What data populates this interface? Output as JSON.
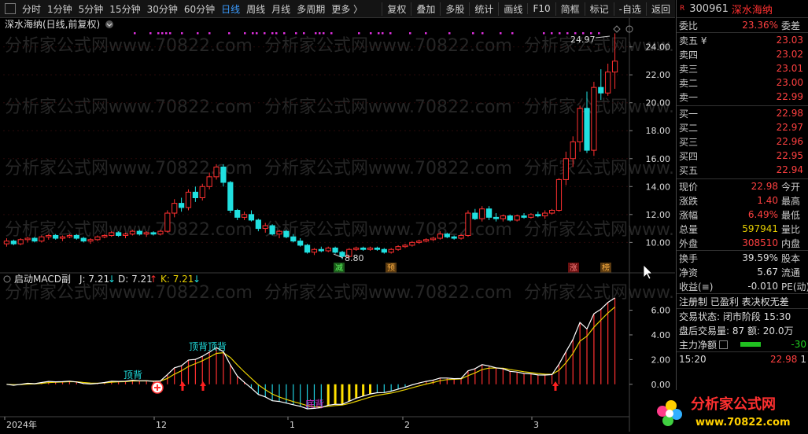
{
  "toolbar": {
    "periods": [
      "分时",
      "1分钟",
      "5分钟",
      "15分钟",
      "30分钟",
      "60分钟",
      "日线",
      "周线",
      "月线",
      "多周期",
      "更多 〉"
    ],
    "active": "日线",
    "actions": [
      "复权",
      "叠加",
      "多股",
      "统计",
      "画线",
      "F10",
      "简框",
      "标记",
      "-自选",
      "返回"
    ]
  },
  "chart": {
    "title": "深水海纳(日线,前复权)",
    "watermark": "分析家公式网www.70822.com",
    "y_ticks": [
      "24.00",
      "22.00",
      "20.00",
      "18.00",
      "16.00",
      "14.00",
      "12.00",
      "10.00"
    ],
    "high_label": "24.97",
    "low_label": "8.80",
    "tags": [
      "减",
      "预",
      "涨",
      "榜"
    ],
    "indicator_name": "启动MACD副",
    "ind_j": "J: 7.21",
    "ind_d": "D: 7.21",
    "ind_k": "K: 7.21",
    "ind_ticks": [
      "6.00",
      "4.00",
      "2.00",
      "0.00"
    ],
    "ann_dingbei1": "顶背",
    "ann_dingbei2": "顶背顶背",
    "ann_dibei": "底背",
    "x_labels": [
      "2024年",
      "12",
      "1",
      "2",
      "3"
    ]
  },
  "panel": {
    "badge": "R",
    "code": "300961",
    "name": "深水海纳",
    "weibi_label": "委比",
    "weibi_value": "23.36%",
    "weicha_label": "委差",
    "sells": [
      {
        "label": "卖五 ¥",
        "price": "23.03"
      },
      {
        "label": "卖四",
        "price": "23.02"
      },
      {
        "label": "卖三",
        "price": "23.01"
      },
      {
        "label": "卖二",
        "price": "23.00"
      },
      {
        "label": "卖一",
        "price": "22.99"
      }
    ],
    "buys": [
      {
        "label": "买一",
        "price": "22.98"
      },
      {
        "label": "买二",
        "price": "22.97"
      },
      {
        "label": "买三",
        "price": "22.96"
      },
      {
        "label": "买四",
        "price": "22.95"
      },
      {
        "label": "买五",
        "price": "22.94"
      }
    ],
    "quote": [
      {
        "l": "现价",
        "v": "22.98",
        "l2": "今开"
      },
      {
        "l": "涨跌",
        "v": "1.40",
        "l2": "最高"
      },
      {
        "l": "涨幅",
        "v": "6.49%",
        "l2": "最低"
      },
      {
        "l": "总量",
        "v": "597941",
        "l2": "量比"
      },
      {
        "l": "外盘",
        "v": "308510",
        "l2": "内盘"
      }
    ],
    "stats": [
      {
        "l": "换手",
        "v": "39.59%",
        "l2": "股本"
      },
      {
        "l": "净资",
        "v": "5.67",
        "l2": "流通"
      },
      {
        "l": "收益(≡)",
        "v": "-0.010",
        "l2": "PE(动)"
      }
    ],
    "info1": "注册制 已盈利 表决权无差",
    "info2": "交易状态: 闭市阶段 15:30",
    "info3": "盘后交易量: 87  额: 20.0万",
    "info4": "主力净额",
    "info4_val": "-30",
    "time_row": "15:20",
    "time_price": "22.98",
    "time_extra": "1"
  },
  "logo": {
    "text": "分析家公式网",
    "url": "www.70822.com"
  },
  "colors": {
    "up": "#ff3030",
    "down": "#20e0e0",
    "bg": "#000000",
    "accent": "#3a9bff"
  },
  "chart_data": {
    "type": "candlestick",
    "ohlc": [
      [
        9.9,
        10.3,
        9.7,
        10.1
      ],
      [
        10.1,
        10.2,
        9.8,
        9.9
      ],
      [
        9.9,
        10.3,
        9.8,
        10.2
      ],
      [
        10.2,
        10.4,
        10.0,
        10.3
      ],
      [
        10.3,
        10.4,
        10.0,
        10.1
      ],
      [
        10.1,
        10.5,
        10.0,
        10.4
      ],
      [
        10.4,
        10.6,
        10.2,
        10.5
      ],
      [
        10.5,
        10.6,
        10.2,
        10.3
      ],
      [
        10.3,
        10.5,
        10.1,
        10.4
      ],
      [
        10.4,
        10.6,
        10.3,
        10.5
      ],
      [
        10.5,
        10.6,
        10.2,
        10.3
      ],
      [
        10.3,
        10.4,
        10.0,
        10.1
      ],
      [
        10.1,
        10.3,
        9.9,
        10.2
      ],
      [
        10.2,
        10.5,
        10.1,
        10.4
      ],
      [
        10.4,
        10.6,
        10.3,
        10.5
      ],
      [
        10.5,
        10.8,
        10.4,
        10.7
      ],
      [
        10.7,
        10.8,
        10.4,
        10.5
      ],
      [
        10.5,
        10.7,
        10.3,
        10.6
      ],
      [
        10.6,
        10.9,
        10.5,
        10.8
      ],
      [
        10.8,
        10.9,
        10.5,
        10.6
      ],
      [
        10.6,
        10.8,
        10.4,
        10.7
      ],
      [
        10.7,
        10.8,
        10.5,
        10.6
      ],
      [
        10.6,
        10.9,
        10.5,
        10.8
      ],
      [
        10.8,
        12.3,
        10.7,
        12.1
      ],
      [
        12.1,
        13.1,
        11.8,
        12.8
      ],
      [
        12.8,
        13.2,
        12.2,
        12.5
      ],
      [
        12.5,
        13.8,
        12.3,
        13.6
      ],
      [
        13.6,
        14.0,
        12.9,
        13.2
      ],
      [
        13.2,
        14.2,
        13.0,
        14.0
      ],
      [
        14.0,
        15.0,
        13.8,
        14.7
      ],
      [
        14.7,
        15.6,
        14.5,
        15.4
      ],
      [
        15.4,
        15.6,
        14.0,
        14.3
      ],
      [
        14.3,
        14.4,
        12.1,
        12.3
      ],
      [
        12.3,
        12.4,
        11.6,
        11.8
      ],
      [
        11.8,
        12.2,
        11.6,
        12.0
      ],
      [
        12.0,
        12.3,
        11.5,
        11.6
      ],
      [
        11.6,
        11.7,
        10.8,
        11.0
      ],
      [
        11.0,
        11.4,
        10.7,
        11.2
      ],
      [
        11.2,
        11.3,
        10.5,
        10.6
      ],
      [
        10.6,
        10.9,
        10.3,
        10.8
      ],
      [
        10.8,
        10.9,
        10.3,
        10.4
      ],
      [
        10.4,
        10.6,
        10.0,
        10.1
      ],
      [
        10.1,
        10.3,
        9.7,
        9.8
      ],
      [
        9.8,
        9.9,
        9.2,
        9.3
      ],
      [
        9.3,
        9.6,
        9.1,
        9.5
      ],
      [
        9.5,
        9.7,
        9.3,
        9.4
      ],
      [
        9.4,
        9.7,
        9.3,
        9.6
      ],
      [
        9.6,
        9.7,
        9.2,
        9.3
      ],
      [
        9.3,
        9.4,
        8.8,
        9.0
      ],
      [
        9.0,
        9.6,
        8.9,
        9.5
      ],
      [
        9.5,
        9.7,
        9.4,
        9.6
      ],
      [
        9.6,
        9.7,
        9.4,
        9.5
      ],
      [
        9.5,
        9.7,
        9.4,
        9.6
      ],
      [
        9.6,
        9.7,
        9.4,
        9.5
      ],
      [
        9.5,
        9.6,
        9.2,
        9.3
      ],
      [
        9.3,
        9.6,
        9.2,
        9.5
      ],
      [
        9.5,
        9.8,
        9.4,
        9.7
      ],
      [
        9.7,
        9.9,
        9.6,
        9.8
      ],
      [
        9.8,
        10.1,
        9.7,
        10.0
      ],
      [
        10.0,
        10.2,
        9.9,
        10.1
      ],
      [
        10.1,
        10.3,
        10.0,
        10.2
      ],
      [
        10.2,
        10.4,
        10.1,
        10.3
      ],
      [
        10.3,
        10.8,
        10.2,
        10.6
      ],
      [
        10.6,
        10.7,
        10.3,
        10.4
      ],
      [
        10.4,
        10.5,
        10.2,
        10.3
      ],
      [
        10.3,
        10.6,
        10.2,
        10.5
      ],
      [
        10.5,
        12.3,
        10.4,
        12.1
      ],
      [
        12.1,
        12.4,
        11.6,
        11.7
      ],
      [
        11.7,
        12.6,
        11.5,
        12.4
      ],
      [
        12.4,
        12.6,
        11.6,
        11.8
      ],
      [
        11.8,
        12.1,
        11.5,
        11.7
      ],
      [
        11.7,
        12.0,
        11.5,
        11.9
      ],
      [
        11.9,
        12.0,
        11.5,
        11.6
      ],
      [
        11.6,
        12.0,
        11.5,
        11.9
      ],
      [
        11.9,
        12.1,
        11.7,
        11.8
      ],
      [
        11.8,
        12.1,
        11.7,
        12.0
      ],
      [
        12.0,
        12.2,
        11.8,
        11.9
      ],
      [
        11.9,
        12.3,
        11.7,
        12.1
      ],
      [
        12.1,
        12.4,
        12.0,
        12.3
      ],
      [
        12.3,
        14.6,
        12.2,
        14.5
      ],
      [
        14.5,
        16.5,
        14.1,
        16.0
      ],
      [
        16.0,
        17.6,
        15.4,
        17.2
      ],
      [
        17.2,
        19.8,
        16.5,
        19.6
      ],
      [
        19.6,
        20.8,
        16.4,
        16.6
      ],
      [
        16.6,
        21.5,
        16.2,
        21.1
      ],
      [
        21.1,
        22.4,
        20.2,
        20.7
      ],
      [
        20.7,
        22.8,
        20.5,
        22.2
      ],
      [
        22.2,
        24.97,
        21.0,
        22.98
      ]
    ],
    "high": 24.97,
    "low": 8.8,
    "ylim": [
      8.5,
      25.5
    ],
    "indicator": {
      "name": "启动MACD副",
      "J": 7.21,
      "D": 7.21,
      "K": 7.21,
      "ylim": [
        -2.5,
        7.5
      ]
    }
  }
}
